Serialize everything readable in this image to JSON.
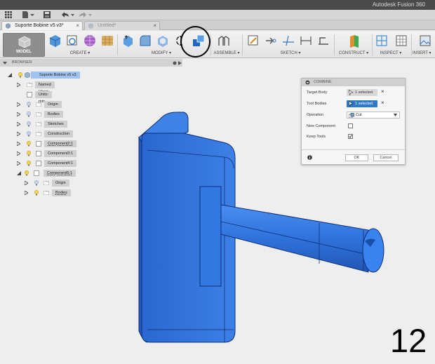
{
  "app": {
    "title": "Autodesk Fusion 360"
  },
  "tabs": [
    {
      "label": "Suporte Bobine v5 v3*",
      "active": true
    },
    {
      "label": "Untitled*",
      "active": false
    }
  ],
  "workspace": {
    "label": "MODEL"
  },
  "ribbon": {
    "groups": [
      "CREATE",
      "MODIFY",
      "ASSEMBLE",
      "SKETCH",
      "CONSTRUCT",
      "INSPECT",
      "INSERT"
    ]
  },
  "browser": {
    "header": "BROWSER",
    "root": "Suporte Bobine v5 v3",
    "items": [
      {
        "label": "Named Views"
      },
      {
        "label": "Units: mm"
      },
      {
        "label": "Origin"
      },
      {
        "label": "Bodies"
      },
      {
        "label": "Sketches"
      },
      {
        "label": "Construction"
      },
      {
        "label": "Component2:1"
      },
      {
        "label": "Component3:1"
      },
      {
        "label": "Component4:1"
      },
      {
        "label": "Component5:1"
      },
      {
        "label": "Origin"
      },
      {
        "label": "Bodies"
      }
    ]
  },
  "dialog": {
    "title": "COMBINE",
    "target_body_label": "Target Body",
    "target_body_value": "1 selected",
    "tool_bodies_label": "Tool Bodies",
    "tool_bodies_value": "1 selected",
    "operation_label": "Operation",
    "operation_value": "Cut",
    "new_component_label": "New Component",
    "new_component_checked": false,
    "keep_tools_label": "Keep Tools",
    "keep_tools_checked": true,
    "ok_label": "OK",
    "cancel_label": "Cancel"
  },
  "step_number": "12",
  "colors": {
    "accent": "#2f78c9",
    "model_blue": "#2f6fd9",
    "model_edge": "#0c2f7a",
    "tool_selected_bg": "#2f78c9"
  }
}
